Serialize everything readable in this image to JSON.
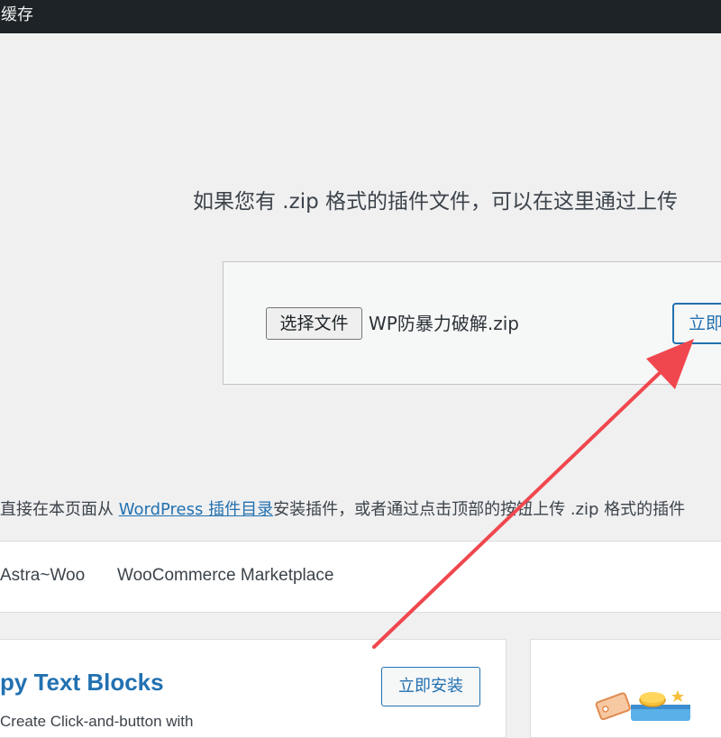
{
  "topbar": {
    "label": "缓存"
  },
  "upload": {
    "description": "如果您有 .zip 格式的插件文件，可以在这里通过上传",
    "choose_file_label": "选择文件",
    "file_name": "WP防暴力破解.zip",
    "install_button_label": "立即安装"
  },
  "help": {
    "prefix": "直接在本页面从 ",
    "link_text": "WordPress 插件目录",
    "suffix": "安装插件，或者通过点击顶部的按钮上传 .zip 格式的插件"
  },
  "filter_tabs": [
    "Astra~Woo",
    "WooCommerce Marketplace"
  ],
  "plugin_card": {
    "title": "py Text Blocks",
    "install_label": "立即安装",
    "description": "Create Click-and-button with"
  },
  "colors": {
    "accent": "#2271b1",
    "admin_bar": "#1d2327",
    "background": "#f0f0f1",
    "annotation_arrow": "#f0474e"
  }
}
